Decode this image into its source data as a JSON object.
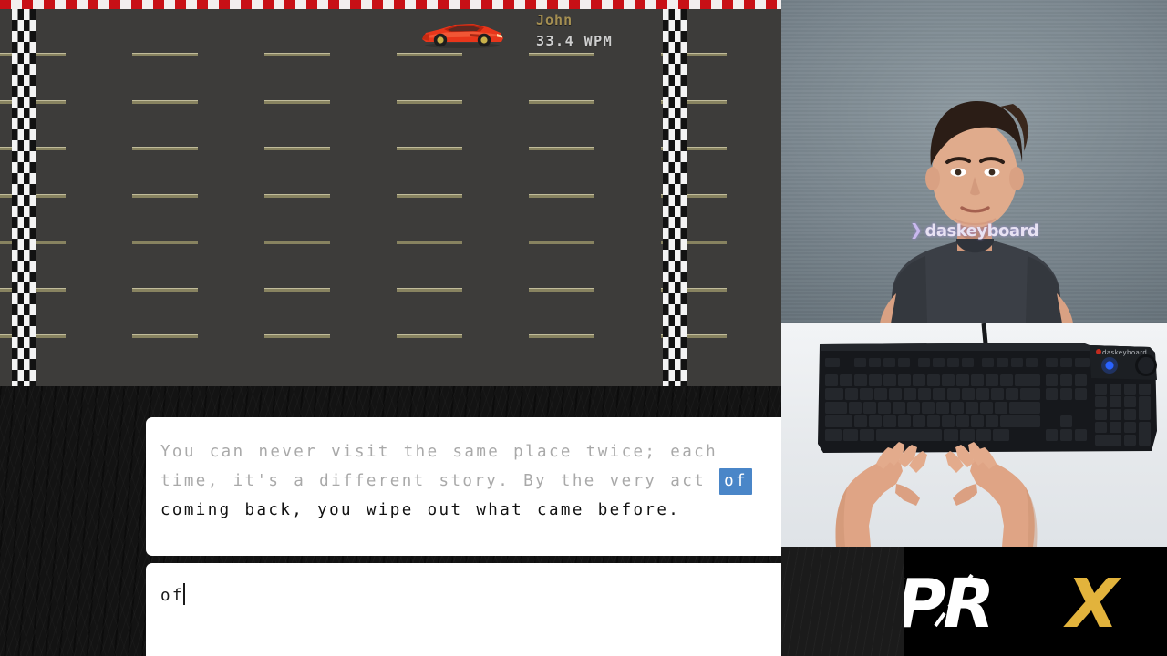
{
  "app": {
    "name": "TYPRX",
    "logo_main": "TYPR",
    "logo_accent": "X",
    "accent_color": "#e2b33c",
    "logo_color": "#ffffff"
  },
  "race": {
    "track_bg_color": "#3d3c3a",
    "lane_dash_color": "#8d8763",
    "checker_red": "#c81016",
    "checker_white": "#f2eeee",
    "lane_count": 7,
    "player": {
      "name": "John",
      "wpm_value": "33.4",
      "wpm_unit": "WPM",
      "wpm_display": "33.4 WPM",
      "name_color": "#a58f52",
      "wpm_color": "#cfcfcf",
      "car_icon": "red-sports-car",
      "car_color": "#e8361b",
      "progress_percent": 58
    }
  },
  "prompt": {
    "full_text": "You can never visit the same place twice; each time, it's a different story. By the very act of coming back, you wipe out what came before.",
    "typed_text": "You can never visit the same place twice; each time, it's a different story. By the very act ",
    "current_word": "of",
    "remaining_text": " coming back, you wipe out what came before.",
    "typed_color": "#a9a9a9",
    "remaining_color": "#111111",
    "highlight_color": "#4a86c8",
    "highlight_text_color": "#ffffff",
    "box_background": "#ffffff"
  },
  "input": {
    "value": "of",
    "placeholder": "",
    "caret_visible": true,
    "box_background": "#ffffff"
  },
  "facecam": {
    "label": "face-webcam",
    "shirt_brand": "daskeyboard",
    "shirt_mark": "❯",
    "shirt_color": "#3b3f46",
    "wall_color": "#7d8a93"
  },
  "keyboardcam": {
    "label": "overhead-keyboard-camera",
    "keyboard_brand": "daskeyboard",
    "keyboard_color": "#14161a",
    "desk_color": "#edf0f2",
    "led_color": "#2a63ff"
  }
}
